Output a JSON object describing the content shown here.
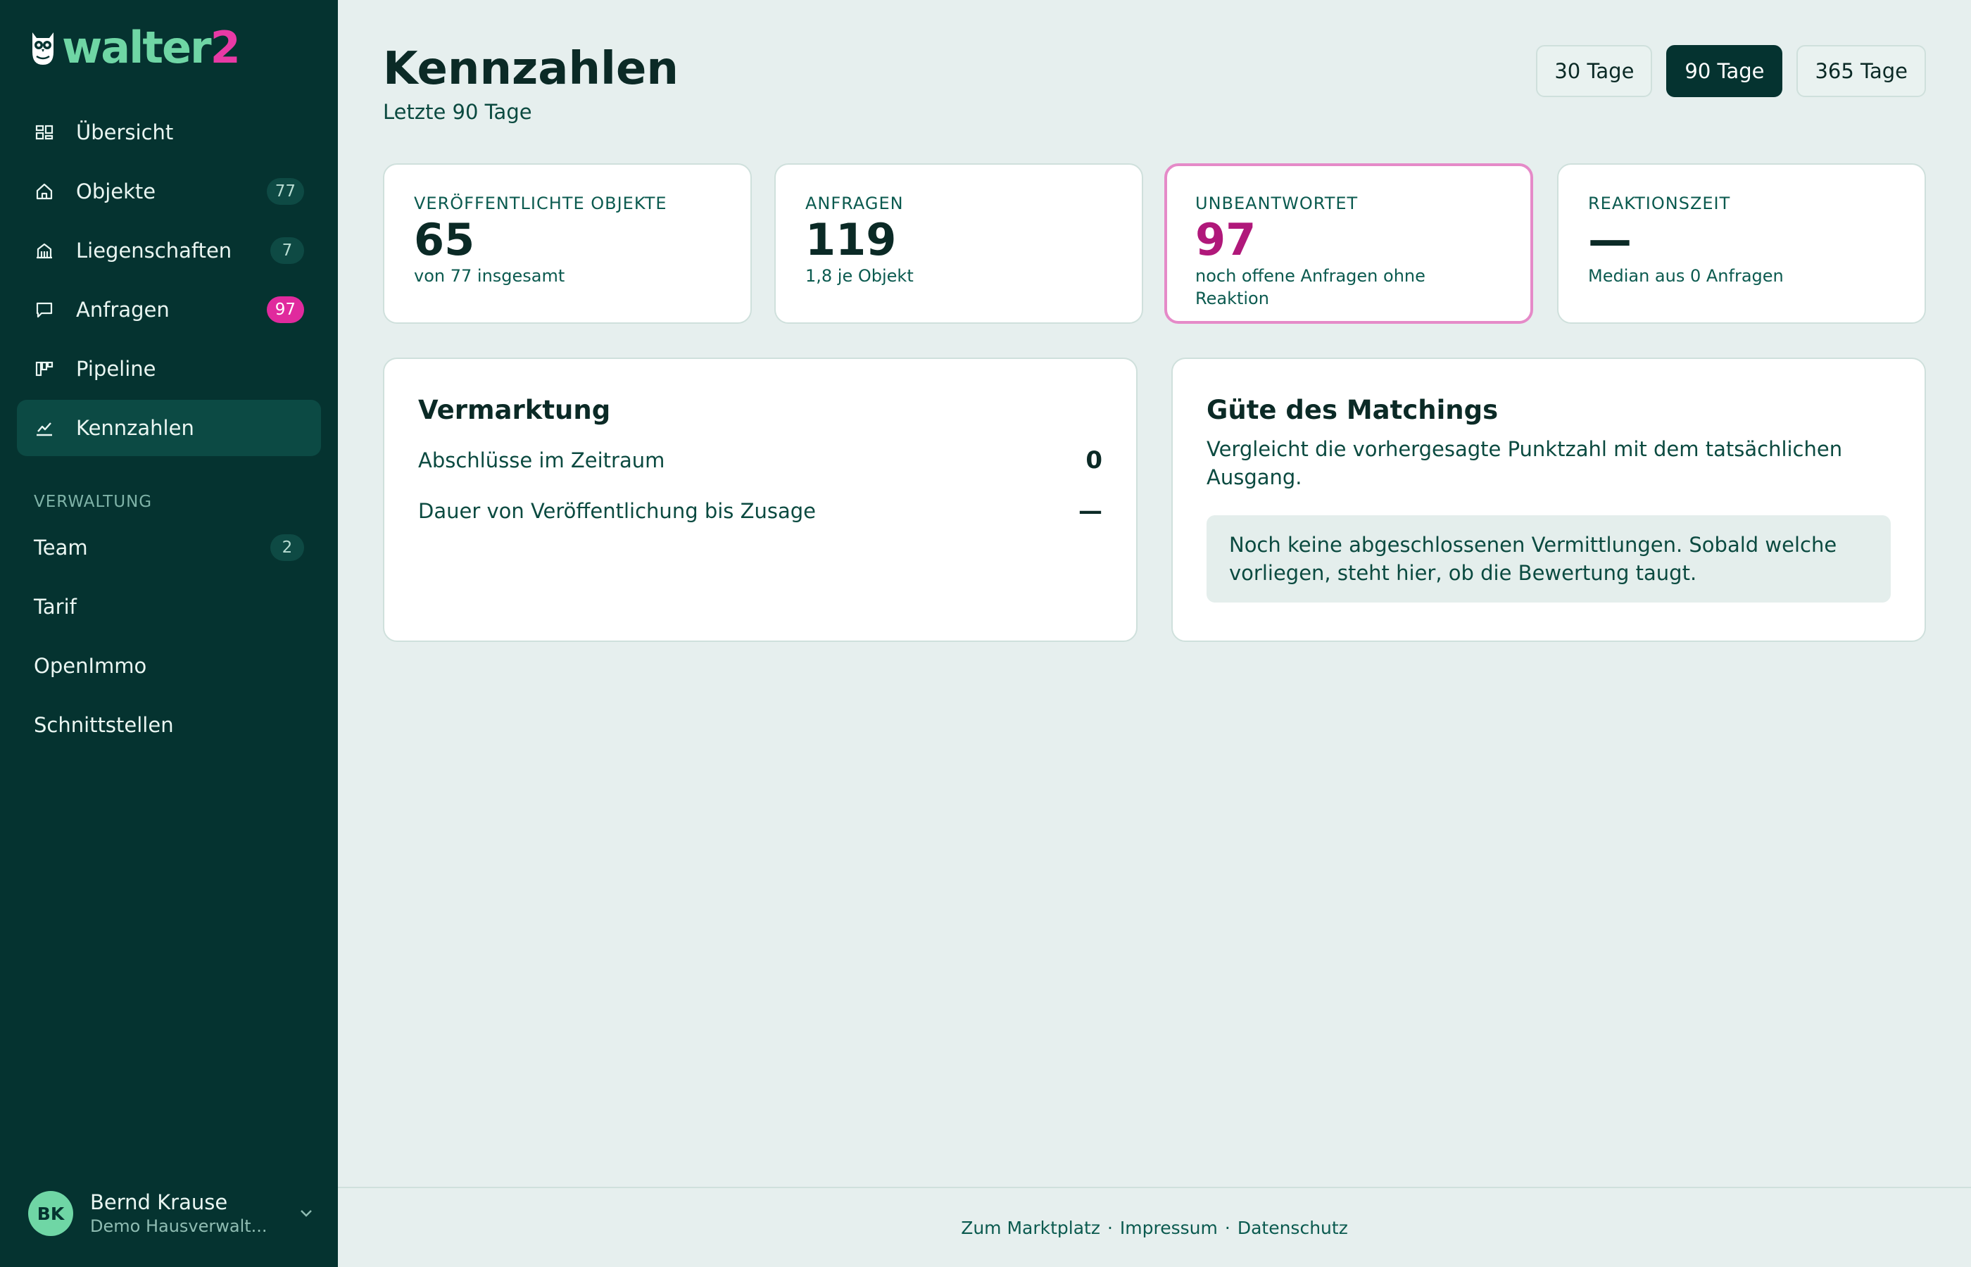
{
  "brand": {
    "name_main": "walter",
    "name_accent": "2"
  },
  "nav": [
    {
      "label": "Übersicht",
      "icon": "dashboard-icon",
      "badge": ""
    },
    {
      "label": "Objekte",
      "icon": "home-icon",
      "badge": "77"
    },
    {
      "label": "Liegenschaften",
      "icon": "building-icon",
      "badge": "7"
    },
    {
      "label": "Anfragen",
      "icon": "chat-icon",
      "badge": "97"
    },
    {
      "label": "Pipeline",
      "icon": "kanban-icon",
      "badge": ""
    },
    {
      "label": "Kennzahlen",
      "icon": "chart-line-icon",
      "badge": ""
    }
  ],
  "admin_section": {
    "title": "VERWALTUNG",
    "items": [
      {
        "label": "Team",
        "badge": "2"
      },
      {
        "label": "Tarif"
      },
      {
        "label": "OpenImmo"
      },
      {
        "label": "Schnittstellen"
      }
    ]
  },
  "user": {
    "initials": "BK",
    "name": "Bernd Krause",
    "org": "Demo Hausverwalt..."
  },
  "page": {
    "title": "Kennzahlen",
    "subtitle": "Letzte 90 Tage"
  },
  "range": {
    "options": [
      "30 Tage",
      "90 Tage",
      "365 Tage"
    ],
    "selected": "90 Tage"
  },
  "stats": [
    {
      "label": "VERÖFFENTLICHTE OBJEKTE",
      "value": "65",
      "sub": "von 77 insgesamt"
    },
    {
      "label": "ANFRAGEN",
      "value": "119",
      "sub": "1,8 je Objekt"
    },
    {
      "label": "UNBEANTWORTET",
      "value": "97",
      "sub": "noch offene Anfragen ohne Reaktion"
    },
    {
      "label": "REAKTIONSZEIT",
      "value": "—",
      "sub": "Median aus 0 Anfragen"
    }
  ],
  "marketing": {
    "title": "Vermarktung",
    "rows": [
      {
        "label": "Abschlüsse im Zeitraum",
        "value": "0"
      },
      {
        "label": "Dauer von Veröffentlichung bis Zusage",
        "value": "—"
      }
    ]
  },
  "matching": {
    "title": "Güte des Matchings",
    "description": "Vergleicht die vorhergesagte Punktzahl mit dem tatsächlichen Ausgang.",
    "notice": "Noch keine abgeschlossenen Vermittlungen. Sobald welche vorliegen, steht hier, ob die Bewertung taugt."
  },
  "footer": {
    "links": [
      "Zum Marktplatz",
      "Impressum",
      "Datenschutz"
    ],
    "separator": "·"
  },
  "colors": {
    "sidebar": "#053330",
    "accent_green": "#6fd6a5",
    "accent_pink": "#e02a9d",
    "highlight_border": "#e58ac8"
  }
}
